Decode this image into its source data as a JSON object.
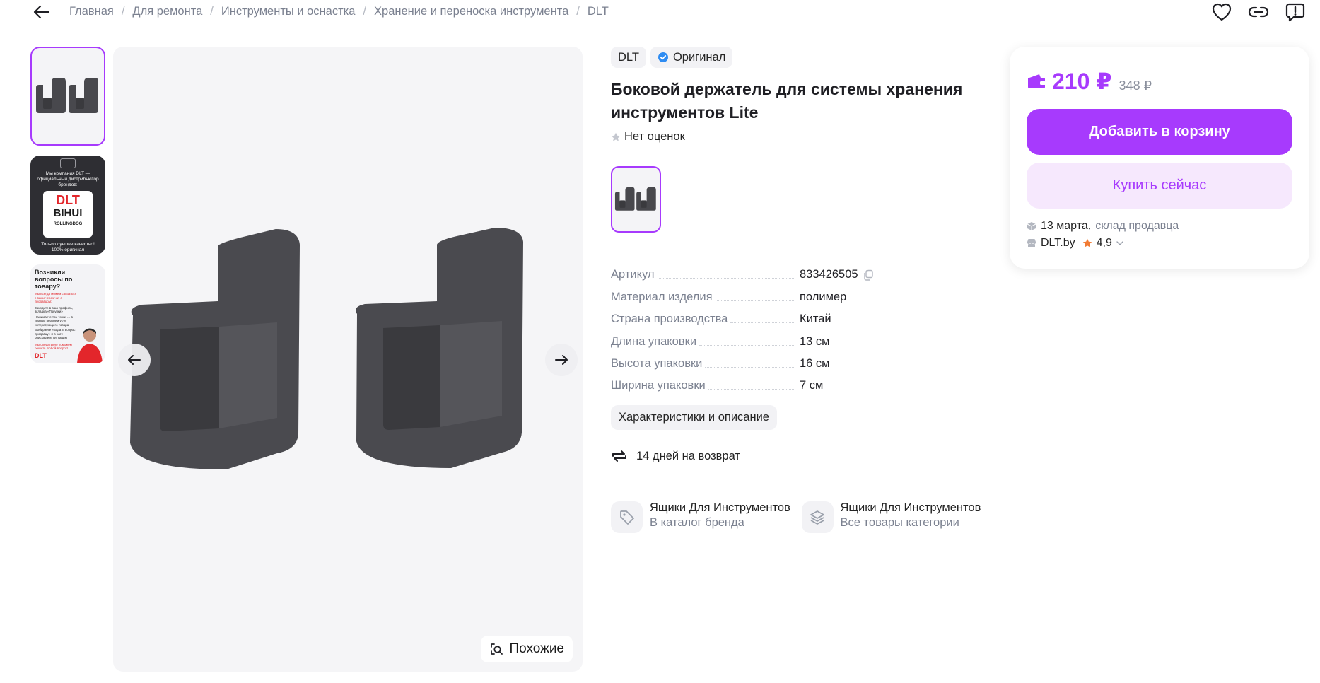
{
  "breadcrumbs": [
    "Главная",
    "Для ремонта",
    "Инструменты и оснастка",
    "Хранение и переноска инструмента",
    "DLT"
  ],
  "gallery": {
    "thumb2_text": {
      "line1": "Мы компания DLT —",
      "line2": "официальный дистрибьютор",
      "line3": "брендов:",
      "brand1": "DLT",
      "brand2": "BIHUI",
      "brand3": "ROLLINGDOG",
      "footer1": "Только лучшее качество!",
      "footer2": "100% оригинал"
    },
    "thumb3_text": {
      "title": "Возникли вопросы по товару?",
      "subtitle": "Мы всегда можем связаться с вами через чат с продавцом:",
      "step1": "Заходите в ваш профиль, вкладка «Покупки»",
      "step2": "Нажимаете три точки … в правом верхнем углу интересующего товара",
      "step3": "Выбираете «Задать вопрос продавцу» и в чате описываете ситуацию",
      "footer": "Мы оперативно поможем решить любой вопрос!",
      "logo": "DLT"
    },
    "similar_label": "Похожие"
  },
  "product": {
    "brand": "DLT",
    "original_label": "Оригинал",
    "title": "Боковой держатель для системы хранения инструментов Lite",
    "rating_text": "Нет оценок",
    "specs": [
      {
        "label": "Артикул",
        "value": "833426505"
      },
      {
        "label": "Материал изделия",
        "value": "полимер"
      },
      {
        "label": "Страна производства",
        "value": "Китай"
      },
      {
        "label": "Длина упаковки",
        "value": "13 см"
      },
      {
        "label": "Высота упаковки",
        "value": "16 см"
      },
      {
        "label": "Ширина упаковки",
        "value": "7 см"
      }
    ],
    "details_chip": "Характеристики и описание",
    "returns": "14 дней на возврат",
    "links": [
      {
        "title": "Ящики Для Инструментов",
        "sub": "В каталог бренда"
      },
      {
        "title": "Ящики Для Инструментов",
        "sub": "Все товары категории"
      }
    ]
  },
  "buy": {
    "price": "210 ₽",
    "old_price": "348 ₽",
    "add_to_cart": "Добавить в корзину",
    "buy_now": "Купить сейчас",
    "delivery_date": "13 марта,",
    "delivery_source": "склад продавца",
    "seller": "DLT.by",
    "seller_rating": "4,9"
  },
  "colors": {
    "accent": "#a73afd",
    "accent_light": "#f6e8fd",
    "muted": "#7b8190"
  }
}
